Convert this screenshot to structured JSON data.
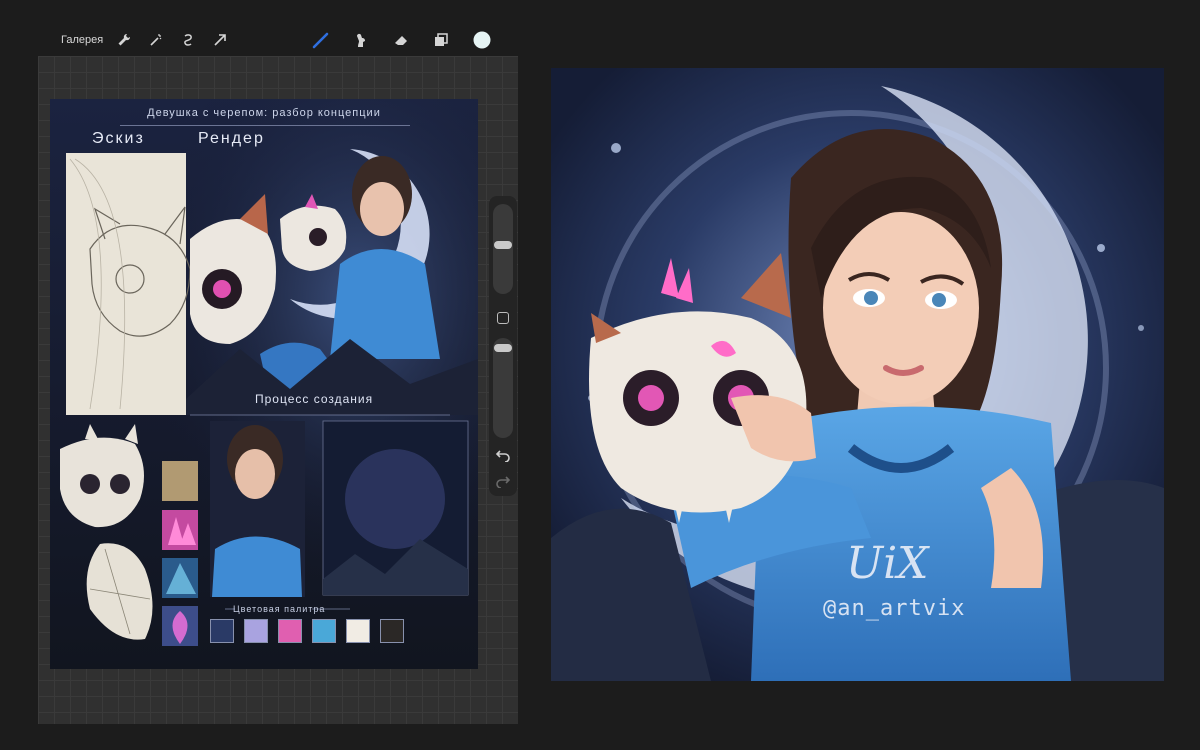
{
  "toolbar": {
    "gallery_label": "Галерея",
    "left_icons": [
      "wrench-icon",
      "magic-wand-icon",
      "selection-icon",
      "transform-arrow-icon"
    ],
    "right_icons": [
      "brush-icon",
      "smudge-icon",
      "eraser-icon",
      "layers-icon",
      "color-circle-icon"
    ],
    "active_tool": "brush",
    "brush_color": "#2f6fe0",
    "current_color": "#e6f4f4"
  },
  "sidebar": {
    "size_slider_level": 0.55,
    "opacity_slider_level": 0.93,
    "modify_button_icon": "square-icon",
    "undo_icon": "undo-arrow-icon",
    "redo_icon": "redo-arrow-icon"
  },
  "board": {
    "title": "Девушка с черепом: разбор концепции",
    "sketch_label": "Эскиз",
    "render_label": "Рендер",
    "process_label": "Процесс создания",
    "palette_label": "Цветовая палитра",
    "palette_colors": [
      "#2a3a66",
      "#a9a3e0",
      "#e05fb0",
      "#4aa8d8",
      "#f1ece4",
      "#2b2826"
    ]
  },
  "artwork": {
    "signature_script": "UiX",
    "signature_handle": "@an_artvix"
  }
}
